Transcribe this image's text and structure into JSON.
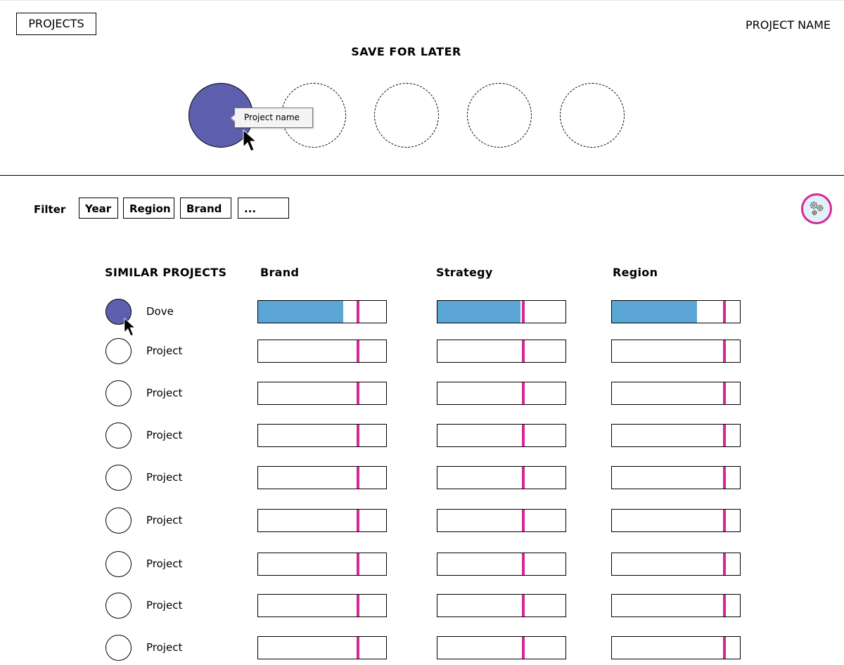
{
  "header": {
    "projects_button": "PROJECTS",
    "project_name": "PROJECT NAME"
  },
  "save_for_later": {
    "title": "SAVE FOR LATER",
    "slots": [
      {
        "filled": true
      },
      {
        "filled": false
      },
      {
        "filled": false
      },
      {
        "filled": false
      },
      {
        "filled": false
      }
    ],
    "tooltip": "Project name"
  },
  "filter": {
    "label": "Filter",
    "options": [
      "Year",
      "Region",
      "Brand",
      "..."
    ]
  },
  "settings": {
    "icon": "gears-icon"
  },
  "similar_projects": {
    "title": "SIMILAR PROJECTS",
    "columns": [
      "Brand",
      "Strategy",
      "Region"
    ],
    "colors": {
      "fill": "#5ba6d4",
      "marker": "#d62796",
      "selected": "#5d5fae"
    },
    "marker_positions": [
      0.76,
      0.65,
      0.86
    ],
    "rows": [
      {
        "label": "Dove",
        "selected": true,
        "values": [
          0.66,
          0.64,
          0.66
        ]
      },
      {
        "label": "Project",
        "selected": false,
        "values": [
          0,
          0,
          0
        ]
      },
      {
        "label": "Project",
        "selected": false,
        "values": [
          0,
          0,
          0
        ]
      },
      {
        "label": "Project",
        "selected": false,
        "values": [
          0,
          0,
          0
        ]
      },
      {
        "label": "Project",
        "selected": false,
        "values": [
          0,
          0,
          0
        ]
      },
      {
        "label": "Project",
        "selected": false,
        "values": [
          0,
          0,
          0
        ]
      },
      {
        "label": "Project",
        "selected": false,
        "values": [
          0,
          0,
          0
        ]
      },
      {
        "label": "Project",
        "selected": false,
        "values": [
          0,
          0,
          0
        ]
      },
      {
        "label": "Project",
        "selected": false,
        "values": [
          0,
          0,
          0
        ]
      }
    ]
  }
}
